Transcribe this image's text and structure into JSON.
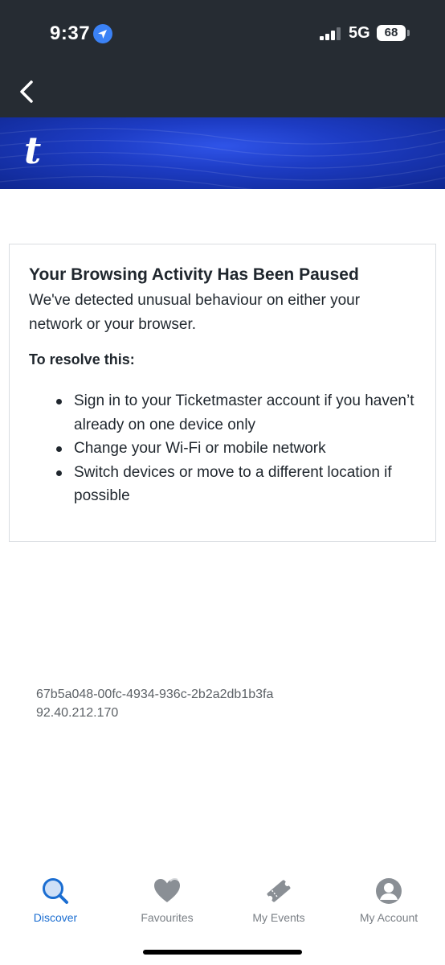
{
  "status_bar": {
    "time": "9:37",
    "network": "5G",
    "battery": "68",
    "icons": [
      "location-arrow-icon",
      "signal-icon",
      "battery-icon"
    ]
  },
  "nav": {
    "back_icon": "chevron-left-icon"
  },
  "brand": {
    "logo_text": "t",
    "color": "#1d3cc4"
  },
  "message": {
    "title": "Your Browsing Activity Has Been Paused",
    "description": "We've detected unusual behaviour on either your network or your browser.",
    "resolve_title": "To resolve this:",
    "steps": [
      "Sign in to your Ticketmaster account if you haven’t already on one device only",
      "Change your Wi-Fi or mobile network",
      "Switch devices or move to a different location if possible"
    ]
  },
  "reference": {
    "id": "67b5a048-00fc-4934-936c-2b2a2db1b3fa",
    "ip": "92.40.212.170"
  },
  "tabs": [
    {
      "label": "Discover",
      "icon": "search-icon",
      "active": true
    },
    {
      "label": "Favourites",
      "icon": "heart-icon",
      "active": false
    },
    {
      "label": "My Events",
      "icon": "ticket-icon",
      "active": false
    },
    {
      "label": "My Account",
      "icon": "user-icon",
      "active": false
    }
  ],
  "colors": {
    "accent": "#1a6dd1",
    "header": "#262c33",
    "inactive_tab": "#7a7f85"
  }
}
